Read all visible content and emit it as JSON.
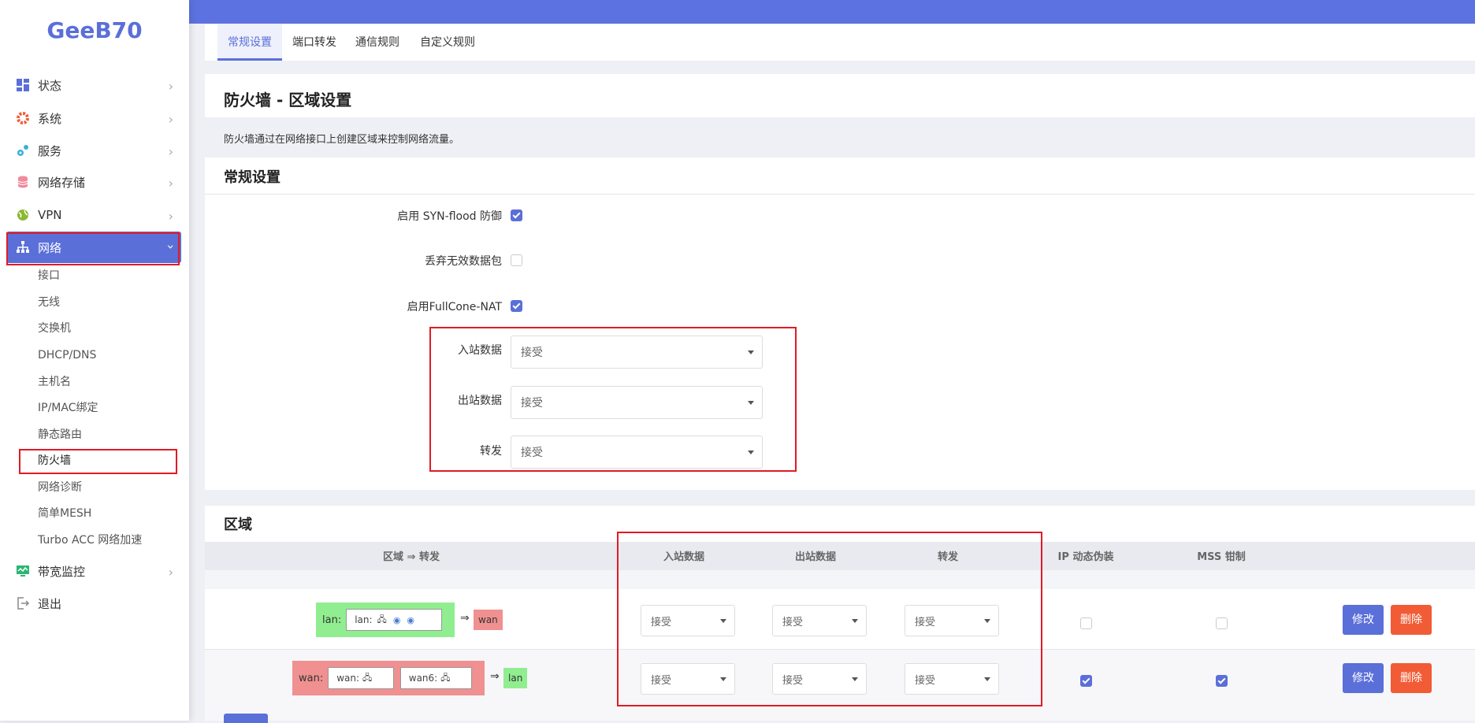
{
  "app": {
    "logo": "GeeB70"
  },
  "sidebar": {
    "items": [
      {
        "label": "状态",
        "icon": "dashboard-icon"
      },
      {
        "label": "系统",
        "icon": "gear-icon"
      },
      {
        "label": "服务",
        "icon": "services-icon"
      },
      {
        "label": "网络存储",
        "icon": "database-icon"
      },
      {
        "label": "VPN",
        "icon": "globe-icon"
      },
      {
        "label": "网络",
        "icon": "network-icon"
      },
      {
        "label": "带宽监控",
        "icon": "monitor-icon"
      },
      {
        "label": "退出",
        "icon": "logout-icon"
      }
    ],
    "subitems": [
      "接口",
      "无线",
      "交换机",
      "DHCP/DNS",
      "主机名",
      "IP/MAC绑定",
      "静态路由",
      "防火墙",
      "网络诊断",
      "简单MESH",
      "Turbo ACC 网络加速"
    ]
  },
  "tabs": [
    "常规设置",
    "端口转发",
    "通信规则",
    "自定义规则"
  ],
  "page": {
    "title": "防火墙 - 区域设置",
    "description": "防火墙通过在网络接口上创建区域来控制网络流量。"
  },
  "general": {
    "title": "常规设置",
    "syn_flood_label": "启用 SYN-flood 防御",
    "drop_invalid_label": "丢弃无效数据包",
    "fullcone_label": "启用FullCone-NAT",
    "input_label": "入站数据",
    "input_value": "接受",
    "output_label": "出站数据",
    "output_value": "接受",
    "forward_label": "转发",
    "forward_value": "接受"
  },
  "zones": {
    "title": "区域",
    "headers": [
      "区域 ⇒ 转发",
      "入站数据",
      "出站数据",
      "转发",
      "IP 动态伪装",
      "MSS 钳制"
    ],
    "rows": [
      {
        "zone": "lan:",
        "iface": "lan:",
        "target": "wan",
        "input": "接受",
        "output": "接受",
        "forward": "接受",
        "masq": false,
        "mss": false
      },
      {
        "zone": "wan:",
        "iface": "wan:",
        "iface2": "wan6:",
        "target": "lan",
        "input": "接受",
        "output": "接受",
        "forward": "接受",
        "masq": true,
        "mss": true
      }
    ],
    "edit_label": "修改",
    "delete_label": "删除",
    "arrow": "⇒"
  },
  "colors": {
    "accent": "#5b6fd9",
    "topbar": "#5b72e0",
    "lan": "#90ee90",
    "wan": "#f09090",
    "delete": "#f15c36",
    "highlight": "#e01b24"
  }
}
